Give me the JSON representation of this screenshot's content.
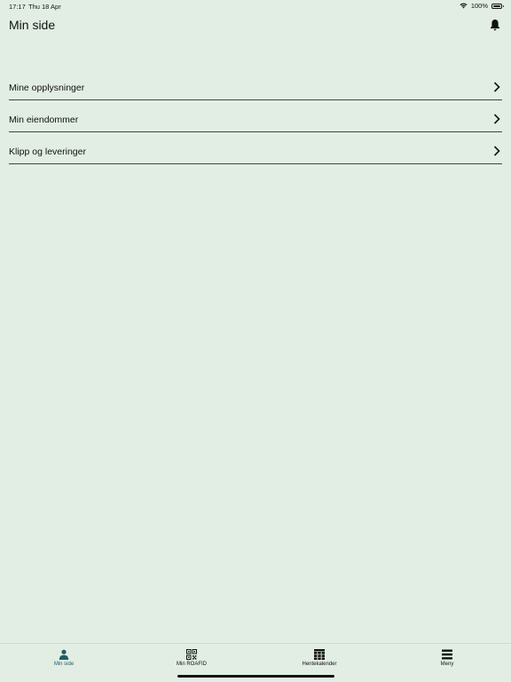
{
  "status_bar": {
    "time": "17:17",
    "date": "Thu 18 Apr",
    "battery_text": "100%",
    "battery_level": 1.0
  },
  "header": {
    "title": "Min side",
    "notification_icon": "bell-icon"
  },
  "menu": {
    "items": [
      {
        "label": "Mine opplysninger",
        "icon": "chevron-right-icon"
      },
      {
        "label": "Min eiendommer",
        "icon": "chevron-right-icon"
      },
      {
        "label": "Klipp og leveringer",
        "icon": "chevron-right-icon"
      }
    ]
  },
  "tab_bar": {
    "tabs": [
      {
        "label": "Min side",
        "icon": "person-icon",
        "active": true
      },
      {
        "label": "Min ROAFID",
        "icon": "qr-code-icon",
        "active": false
      },
      {
        "label": "Hentekalender",
        "icon": "calendar-grid-icon",
        "active": false
      },
      {
        "label": "Meny",
        "icon": "hamburger-menu-icon",
        "active": false
      }
    ]
  },
  "colors": {
    "background": "#e2eee4",
    "accent": "#1f5d66",
    "text": "#111111"
  }
}
